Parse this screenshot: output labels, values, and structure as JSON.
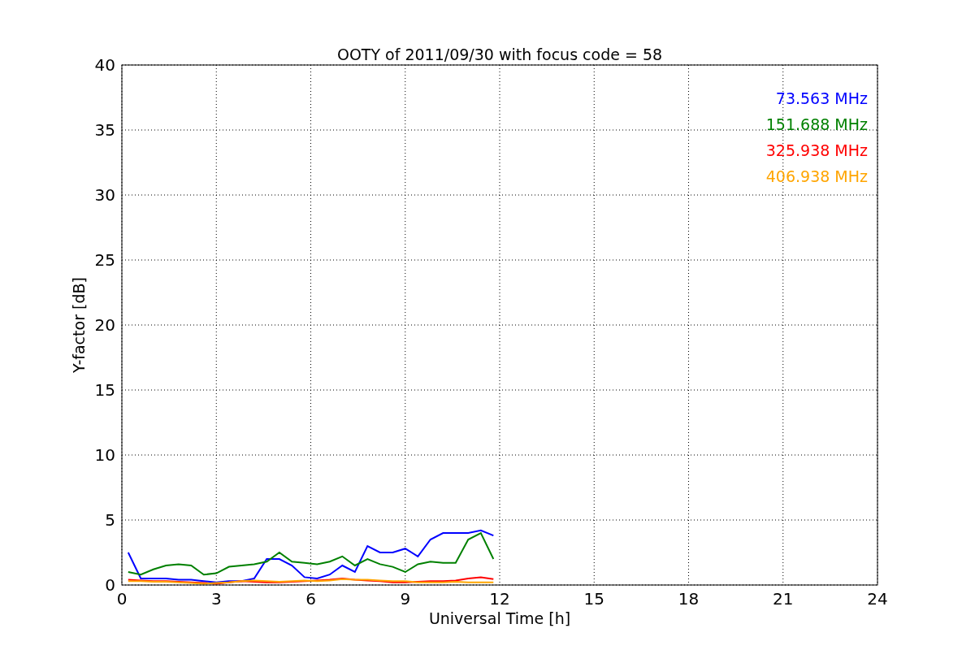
{
  "chart_data": {
    "type": "line",
    "title": "OOTY of 2011/09/30 with focus code = 58",
    "xlabel": "Universal Time [h]",
    "ylabel": "Y-factor [dB]",
    "x": [
      0.2,
      0.6,
      1.0,
      1.4,
      1.8,
      2.2,
      2.6,
      3.0,
      3.4,
      3.8,
      4.2,
      4.6,
      5.0,
      5.4,
      5.8,
      6.2,
      6.6,
      7.0,
      7.4,
      7.8,
      8.2,
      8.6,
      9.0,
      9.4,
      9.8,
      10.2,
      10.6,
      11.0,
      11.4,
      11.8
    ],
    "series": [
      {
        "name": "73.563 MHz",
        "color": "#0000ff",
        "values": [
          2.5,
          0.5,
          0.5,
          0.5,
          0.4,
          0.4,
          0.3,
          0.2,
          0.3,
          0.3,
          0.5,
          2.0,
          2.0,
          1.5,
          0.6,
          0.5,
          0.8,
          1.5,
          1.0,
          3.0,
          2.5,
          2.5,
          2.8,
          2.2,
          3.5,
          4.0,
          4.0,
          4.0,
          4.2,
          3.8
        ]
      },
      {
        "name": "151.688 MHz",
        "color": "#008000",
        "values": [
          1.0,
          0.8,
          1.2,
          1.5,
          1.6,
          1.5,
          0.8,
          0.9,
          1.4,
          1.5,
          1.6,
          1.8,
          2.5,
          1.8,
          1.7,
          1.6,
          1.8,
          2.2,
          1.5,
          2.0,
          1.6,
          1.4,
          1.0,
          1.6,
          1.8,
          1.7,
          1.7,
          3.5,
          4.0,
          2.0
        ]
      },
      {
        "name": "325.938 MHz",
        "color": "#ff0000",
        "values": [
          0.4,
          0.35,
          0.3,
          0.3,
          0.25,
          0.2,
          0.15,
          0.1,
          0.2,
          0.3,
          0.25,
          0.2,
          0.2,
          0.25,
          0.3,
          0.35,
          0.4,
          0.5,
          0.4,
          0.35,
          0.3,
          0.2,
          0.2,
          0.25,
          0.3,
          0.3,
          0.35,
          0.5,
          0.6,
          0.45
        ]
      },
      {
        "name": "406.938 MHz",
        "color": "#ffa500",
        "values": [
          0.3,
          0.3,
          0.25,
          0.25,
          0.2,
          0.15,
          0.1,
          0.15,
          0.2,
          0.3,
          0.35,
          0.3,
          0.25,
          0.3,
          0.35,
          0.3,
          0.35,
          0.45,
          0.4,
          0.4,
          0.35,
          0.3,
          0.3,
          0.2,
          0.2,
          0.2,
          0.25,
          0.2,
          0.2,
          0.2
        ]
      }
    ],
    "xlim": [
      0,
      24
    ],
    "ylim": [
      0,
      40
    ],
    "xticks": [
      0,
      3,
      6,
      9,
      12,
      15,
      18,
      21,
      24
    ],
    "yticks": [
      0,
      5,
      10,
      15,
      20,
      25,
      30,
      35,
      40
    ],
    "grid": true
  }
}
